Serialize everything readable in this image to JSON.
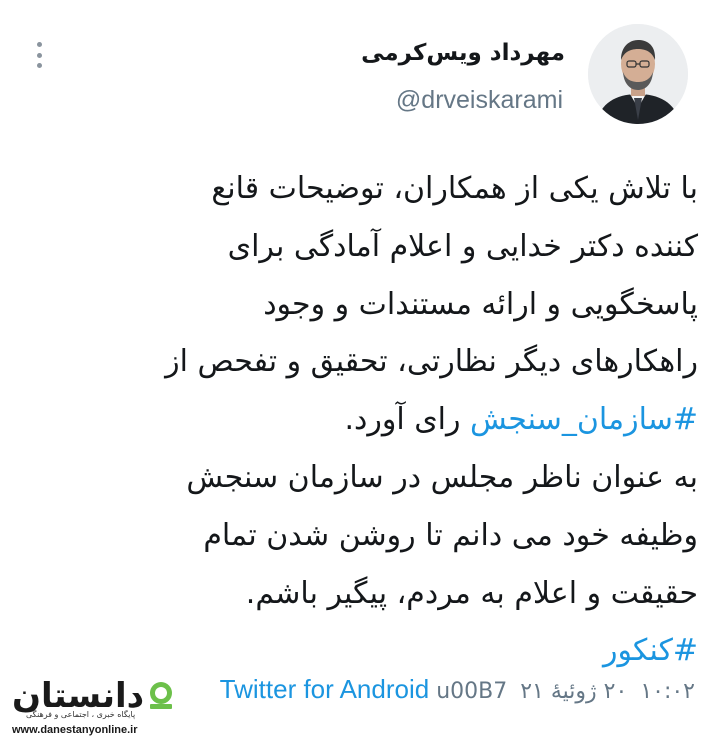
{
  "tweet": {
    "author_name": "مهرداد ویس‌کرمی",
    "handle": "@drveiskarami",
    "lines": [
      [
        {
          "text": "با تلاش یکی از همکاران، توضیحات قانع",
          "hashtag": false
        }
      ],
      [
        {
          "text": "کننده دکتر خدایی و اعلام آمادگی برای",
          "hashtag": false
        }
      ],
      [
        {
          "text": "پاسخگویی و ارائه مستندات و وجود",
          "hashtag": false
        }
      ],
      [
        {
          "text": "راهکارهای دیگر نظارتی، تحقیق و تفحص از",
          "hashtag": false
        }
      ],
      [
        {
          "text": "#سازمان_سنجش",
          "hashtag": true
        },
        {
          "text": " رای آورد.",
          "hashtag": false
        }
      ],
      [
        {
          "text": "به عنوان ناظر مجلس در سازمان سنجش",
          "hashtag": false
        }
      ],
      [
        {
          "text": "وظیفه خود می دانم تا روشن شدن تمام",
          "hashtag": false
        }
      ],
      [
        {
          "text": "حقیقت و اعلام به مردم، پیگیر باشم.",
          "hashtag": false
        }
      ],
      [
        {
          "text": "#کنکور",
          "hashtag": true
        }
      ]
    ]
  },
  "meta": {
    "time": "۱۰:۰۲",
    "date": "۲۰ ژوئیهٔ ۲۱",
    "separator": "u00B7",
    "source": "Twitter for Android"
  },
  "watermark": {
    "logo": "دانستان",
    "subtitle": "پایگاه خبری ، اجتماعی و فرهنگی",
    "url": "www.danestanyonline.ir"
  },
  "icons": {
    "more": "more-vertical-icon",
    "badge": "watermark-badge-icon"
  },
  "colors": {
    "link": "#1b95e0",
    "muted": "#657786"
  }
}
